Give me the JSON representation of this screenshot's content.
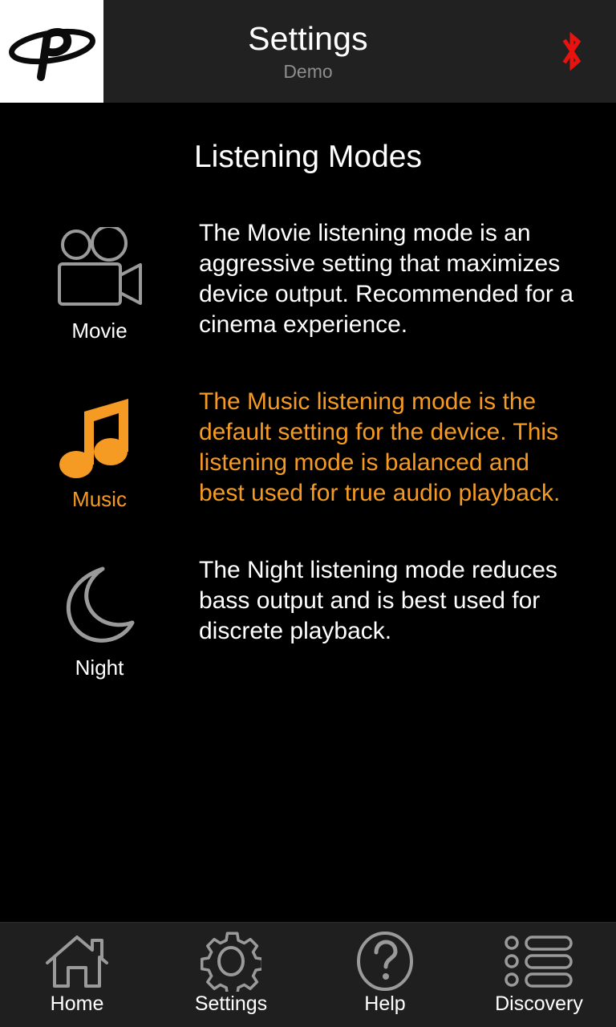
{
  "header": {
    "logo_icon": "brand-p-logo",
    "title": "Settings",
    "subtitle": "Demo",
    "bluetooth_icon": "bluetooth-icon",
    "bluetooth_color": "#e8130f",
    "background_color": "#212121"
  },
  "main": {
    "page_title": "Listening Modes",
    "accent_color": "#f59a22",
    "text_color": "#ffffff",
    "background_color": "#000000",
    "modes": [
      {
        "label": "Movie",
        "icon": "movie-camera-icon",
        "description": "The Movie listening mode is an aggressive setting that maximizes device output. Recommended for a cinema experience.",
        "selected": false
      },
      {
        "label": "Music",
        "icon": "music-note-icon",
        "description": "The Music listening mode is the default setting for the device. This listening mode is balanced and best used for true audio playback.",
        "selected": true
      },
      {
        "label": "Night",
        "icon": "crescent-moon-icon",
        "description": "The Night listening mode reduces bass output and is best used for discrete playback.",
        "selected": false
      }
    ]
  },
  "navbar": {
    "background_color": "#1f1f1f",
    "items": [
      {
        "label": "Home",
        "icon": "home-icon"
      },
      {
        "label": "Settings",
        "icon": "gear-icon"
      },
      {
        "label": "Help",
        "icon": "question-circle-icon"
      },
      {
        "label": "Discovery",
        "icon": "list-icon"
      }
    ]
  }
}
